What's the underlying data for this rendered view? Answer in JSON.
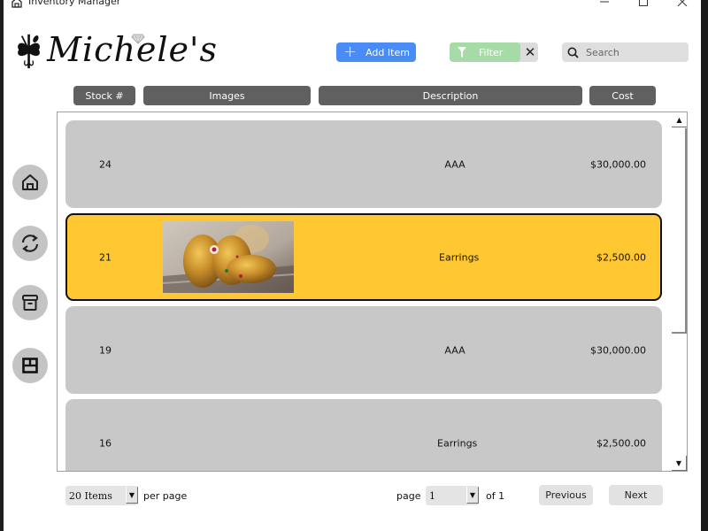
{
  "window": {
    "title": "Inventory Manager",
    "controls": {
      "minimize": "—",
      "maximize": "☐",
      "close": "✕"
    }
  },
  "brand": {
    "logo_text": "Michele's",
    "logo_icon": "butterfly-fork-spoon-icon",
    "gem_icon": "diamond-icon"
  },
  "toolbar": {
    "add_item_label": "Add Item",
    "add_item_icon": "plus-icon",
    "filter_label": "Filter",
    "filter_icon": "funnel-icon",
    "filter_clear_label": "✕",
    "search_placeholder": "Search",
    "search_value": "",
    "search_icon": "magnifier-icon",
    "colors": {
      "add": "#4a8cf6",
      "filter": "#a6dba8",
      "search_bg": "#dedede"
    }
  },
  "columns": [
    {
      "label": "Stock #"
    },
    {
      "label": "Images"
    },
    {
      "label": "Description"
    },
    {
      "label": "Cost"
    }
  ],
  "sidebar": {
    "items": [
      {
        "name": "home",
        "icon": "home-icon"
      },
      {
        "name": "sync",
        "icon": "refresh-icon"
      },
      {
        "name": "archive",
        "icon": "archive-box-icon"
      },
      {
        "name": "layout",
        "icon": "layout-icon"
      }
    ]
  },
  "list": {
    "selected_color": "#ffc832",
    "row_color": "#c8c8c8",
    "rows": [
      {
        "stock": "24",
        "has_image": false,
        "description": "AAA",
        "cost": "$30,000.00",
        "selected": false
      },
      {
        "stock": "21",
        "has_image": true,
        "image_alt": "Gold jeweled bangles",
        "description": "Earrings",
        "cost": "$2,500.00",
        "selected": true
      },
      {
        "stock": "19",
        "has_image": false,
        "description": "AAA",
        "cost": "$30,000.00",
        "selected": false
      },
      {
        "stock": "16",
        "has_image": false,
        "description": "Earrings",
        "cost": "$2,500.00",
        "selected": false
      }
    ],
    "scroll_position": 0
  },
  "pagination": {
    "items_per_page": "20 Items",
    "per_page_label": "per page",
    "page_label": "page",
    "current_page": "1",
    "of_label": "of 1",
    "previous_label": "Previous",
    "next_label": "Next"
  }
}
